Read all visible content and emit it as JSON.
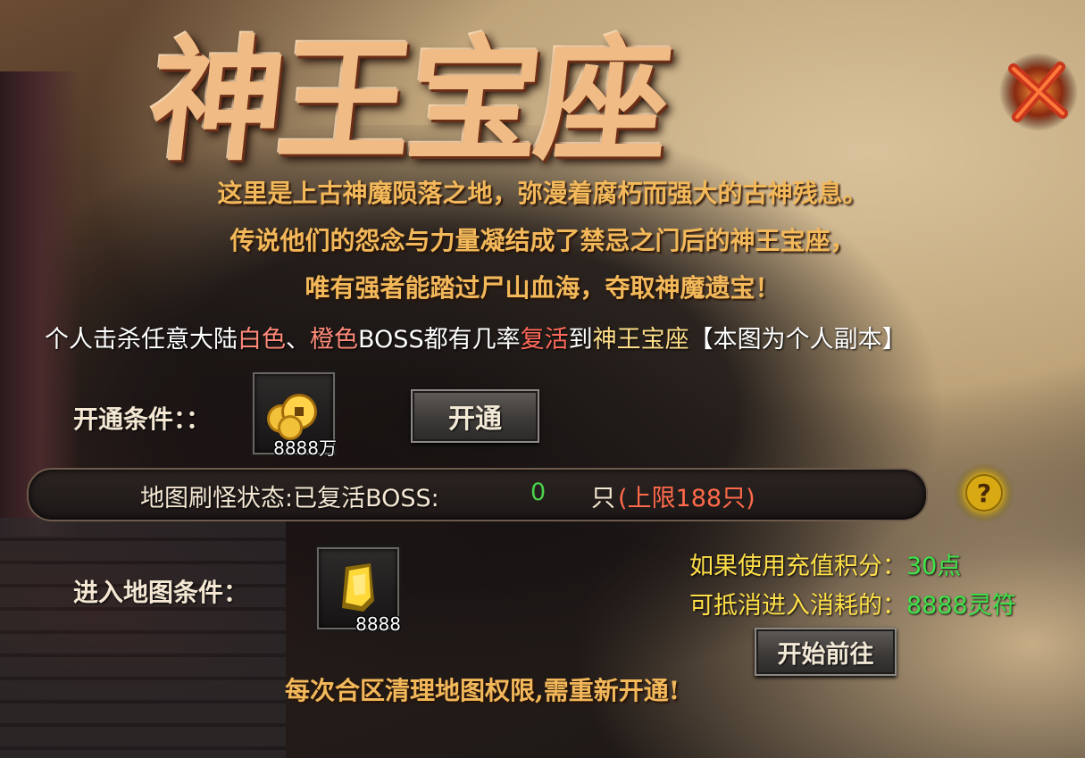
{
  "window": {
    "title": "神王宝座"
  },
  "lore": {
    "line1": "这里是上古神魔陨落之地，弥漫着腐朽而强大的古神残息。",
    "line2": "传说他们的怨念与力量凝结成了禁忌之门后的神王宝座，",
    "line3": "唯有强者能踏过尸山血海，夺取神魔遗宝！"
  },
  "notice": {
    "part1": "个人击杀任意大陆",
    "white": "白色",
    "sep": "、",
    "orange": "橙色",
    "part2": "BOSS都有几率",
    "revive": "复活",
    "part3": "到",
    "map_name": "神王宝座",
    "part4": "【本图为个人副本】"
  },
  "unlock": {
    "label": "开通条件：：",
    "item_icon": "gold-coins-icon",
    "item_qty": "8888万",
    "button_label": "开通"
  },
  "status": {
    "label": "地图刷怪状态:已复活BOSS:",
    "count": "0",
    "unit": "只",
    "limit": "(上限188只)"
  },
  "entry": {
    "label": "进入地图条件：",
    "item_icon": "gold-talisman-icon",
    "item_qty": "8888",
    "cost_line1_label": "如果使用充值积分：",
    "cost_line1_value": "30点",
    "cost_line2_label": "可抵消进入消耗的：",
    "cost_line2_value": "8888灵符",
    "button_label": "开始前往"
  },
  "footer": {
    "text": "每次合区清理地图权限,需重新开通!"
  },
  "colors": {
    "gold_text": "#f2b85a",
    "green_value": "#3fe34a",
    "red_value": "#ff6a4a",
    "yellow_text": "#ffe04a"
  }
}
